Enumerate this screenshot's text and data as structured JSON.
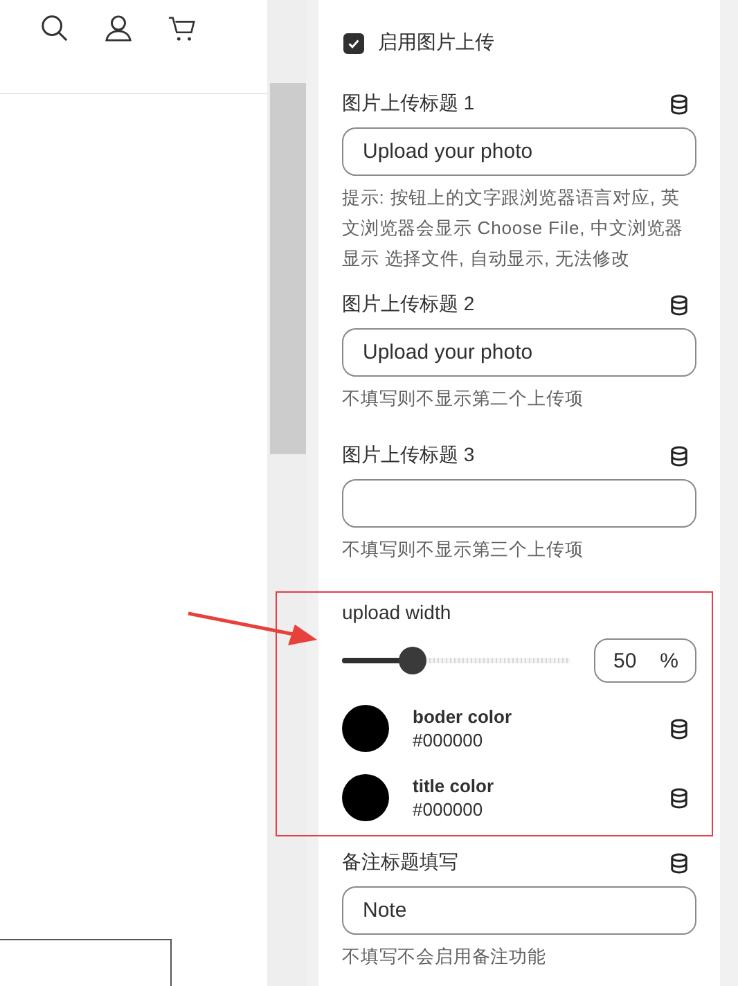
{
  "enable_upload": {
    "label": "启用图片上传",
    "checked": true
  },
  "upload_fields": [
    {
      "label": "图片上传标题 1",
      "value": "Upload your photo",
      "hint": "提示: 按钮上的文字跟浏览器语言对应, 英文浏览器会显示 Choose File, 中文浏览器显示 选择文件, 自动显示, 无法修改"
    },
    {
      "label": "图片上传标题 2",
      "value": "Upload your photo",
      "hint": "不填写则不显示第二个上传项"
    },
    {
      "label": "图片上传标题 3",
      "hint": "不填写则不显示第三个上传项"
    }
  ],
  "upload_width": {
    "label": "upload width",
    "level": 0.31,
    "value": "50",
    "unit": "%"
  },
  "color_settings": [
    {
      "label": "boder color",
      "value": "#000000",
      "color": "#000000"
    },
    {
      "label": "title color",
      "value": "#000000",
      "color": "#000000"
    }
  ],
  "note_field": {
    "label": "备注标题填写",
    "value": "Note",
    "hint": "不填写不会启用备注功能"
  }
}
